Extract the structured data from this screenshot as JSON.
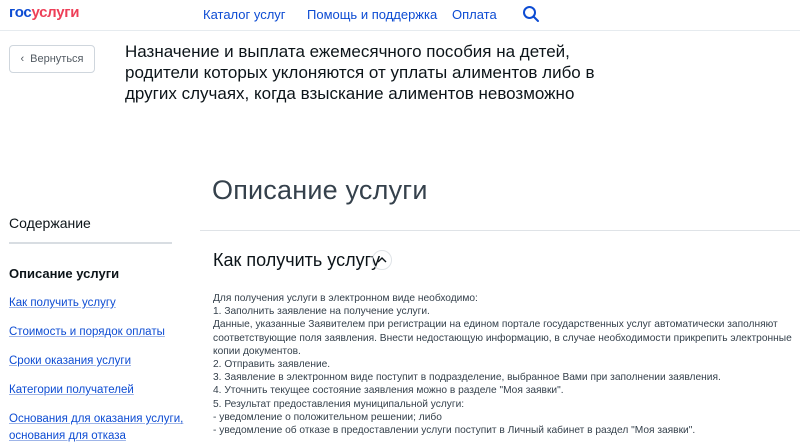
{
  "header": {
    "logo_gos": "гос",
    "logo_uslugi": "услуги",
    "nav": [
      "Каталог услуг",
      "Помощь и поддержка",
      "Оплата"
    ],
    "search_icon": "search-icon",
    "accent_color": "#0d4cd3",
    "logo_red": "#ee3f58"
  },
  "back_button": {
    "label": "Вернуться",
    "icon": "chevron-left-icon"
  },
  "service": {
    "title_lines": [
      "Назначение и выплата ежемесячного пособия на детей,",
      "родители которых уклоняются от уплаты алиментов либо в",
      "других случаях, когда взыскание алиментов невозможно"
    ]
  },
  "section_title": "Описание услуги",
  "toc": {
    "title": "Содержание",
    "current": "Описание услуги",
    "links": [
      "Как получить услугу",
      "Стоимость и порядок оплаты",
      "Сроки оказания услуги",
      "Категории получателей",
      "Основания для оказания услуги,",
      "основания для отказа"
    ]
  },
  "how_to": {
    "heading": "Как получить услугу",
    "toggle_icon": "chevron-up-icon",
    "lines": [
      "Для получения услуги в электронном виде необходимо:",
      "1. Заполнить заявление на получение услуги.",
      "Данные, указанные Заявителем при регистрации на едином портале государственных услуг автоматически заполняют",
      "соответствующие поля заявления. Внести недостающую информацию, в случае необходимости прикрепить электронные",
      "копии документов.",
      "2. Отправить заявление.",
      "3. Заявление в электронном виде поступит в подразделение, выбранное Вами при заполнении заявления.",
      "4. Уточнить текущее состояние заявления можно в разделе \"Моя заявки\".",
      "5. Результат предоставления муниципальной услуги:",
      "- уведомление о положительном решении; либо",
      "- уведомление об отказе в предоставлении услуги поступит в Личный кабинет в раздел \"Моя заявки\"."
    ]
  }
}
